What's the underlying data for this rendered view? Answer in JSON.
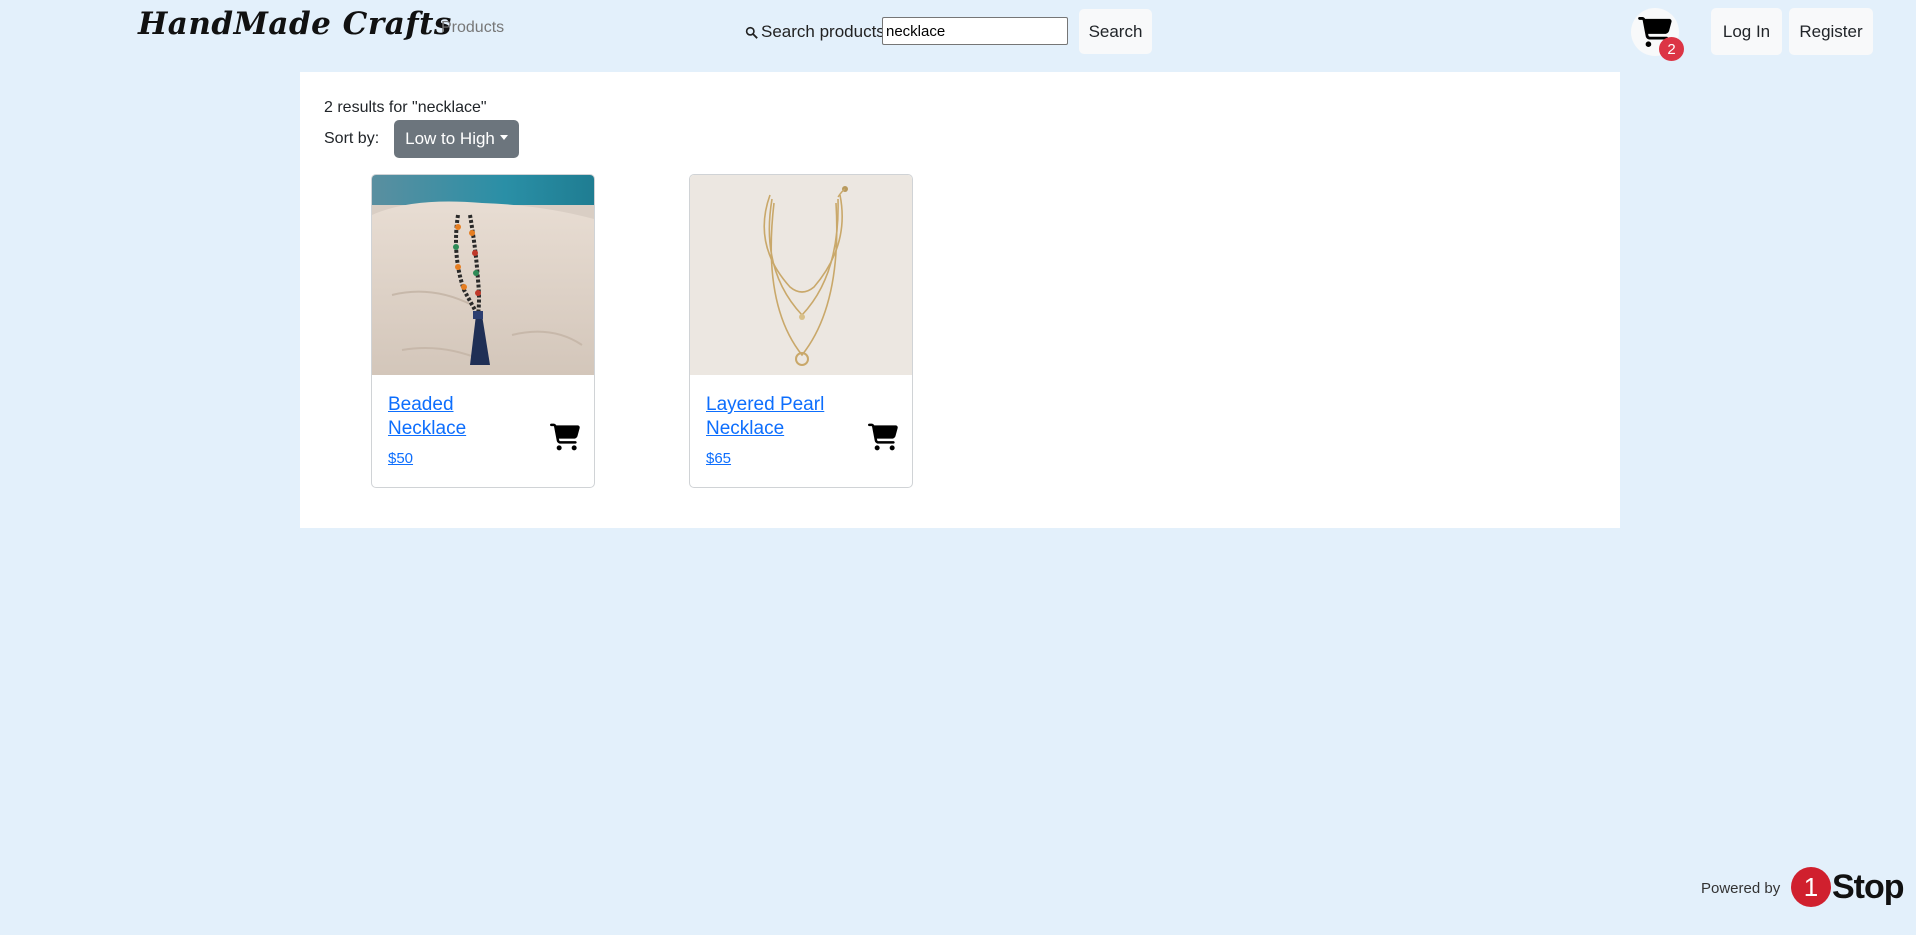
{
  "header": {
    "brand": "HandMade Crafts",
    "nav_products": "Products",
    "search_label": "Search products",
    "search_value": "necklace",
    "search_button": "Search",
    "cart_count": "2",
    "login": "Log In",
    "register": "Register"
  },
  "results": {
    "summary": "2 results for \"necklace\"",
    "sort_label": "Sort by:",
    "sort_value": "Low to High"
  },
  "products": [
    {
      "title": "Beaded Necklace",
      "price": "$50",
      "image": "beaded-necklace-photo"
    },
    {
      "title": "Layered Pearl Necklace",
      "price": "$65",
      "image": "layered-pearl-necklace-photo"
    }
  ],
  "footer": {
    "powered_by": "Powered by",
    "logo_number": "1",
    "logo_text": "Stop"
  },
  "colors": {
    "background": "#e3f0fb",
    "link": "#0d6efd",
    "badge": "#dc3545",
    "sort_button": "#6c757d",
    "logo_red": "#d0202e"
  },
  "icons": [
    "search-icon",
    "cart-icon",
    "add-to-cart-icon"
  ]
}
